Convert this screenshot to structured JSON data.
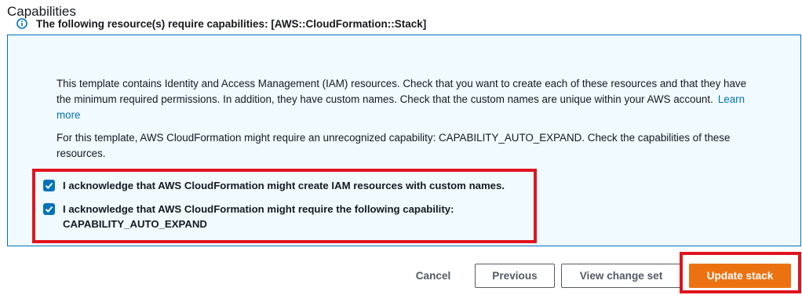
{
  "section": {
    "title": "Capabilities"
  },
  "alert": {
    "icon": "info-circle-icon",
    "title": "The following resource(s) require capabilities: [AWS::CloudFormation::Stack]",
    "paragraph1": "This template contains Identity and Access Management (IAM) resources. Check that you want to create each of these resources and that they have the minimum required permissions. In addition, they have custom names. Check that the custom names are unique within your AWS account.",
    "learn_more": "Learn more",
    "paragraph2": "For this template, AWS CloudFormation might require an unrecognized capability: CAPABILITY_AUTO_EXPAND. Check the capabilities of these resources."
  },
  "acknowledgements": {
    "iam_label": "I acknowledge that AWS CloudFormation might create IAM resources with custom names.",
    "iam_checked": true,
    "capability_label_line1": "I acknowledge that AWS CloudFormation might require the following capability:",
    "capability_label_line2": "CAPABILITY_AUTO_EXPAND",
    "capability_checked": true
  },
  "footer": {
    "cancel": "Cancel",
    "previous": "Previous",
    "view_change_set": "View change set",
    "update_stack": "Update stack"
  },
  "colors": {
    "accent": "#0073bb",
    "primary_button": "#ec7211",
    "highlight": "#e0141e",
    "panel_bg": "#f1faff"
  }
}
